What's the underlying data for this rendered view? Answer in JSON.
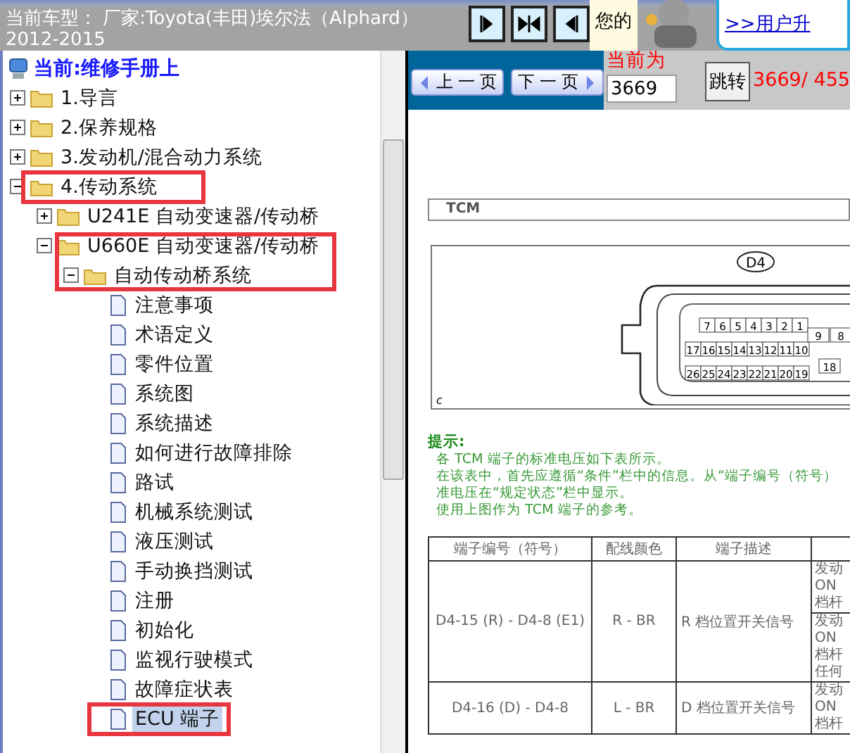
{
  "topbar": {
    "vehicle_line1": "当前车型： 厂家:Toyota(丰田)埃尔法（Alphard）",
    "vehicle_line2": "2012-2015",
    "view_buttons": [
      {
        "kind": "right"
      },
      {
        "kind": "both"
      },
      {
        "kind": "left"
      }
    ],
    "notice_text": "您的",
    "upgrade_link": ">>用户升"
  },
  "tree": {
    "header": "当前:维修手册上",
    "items": [
      {
        "label": "1.导言",
        "kind": "folder",
        "expanded": false,
        "selected": false
      },
      {
        "label": "2.保养规格",
        "kind": "folder",
        "expanded": false,
        "selected": false
      },
      {
        "label": "3.发动机/混合动力系统",
        "kind": "folder",
        "expanded": false,
        "selected": false
      },
      {
        "label": "4.传动系统",
        "kind": "folder",
        "expanded": true,
        "selected": false,
        "children": [
          {
            "label": "U241E 自动变速器/传动桥",
            "kind": "folder",
            "expanded": false,
            "selected": false
          },
          {
            "label": "U660E 自动变速器/传动桥",
            "kind": "folder",
            "expanded": true,
            "selected": false,
            "children": [
              {
                "label": "自动传动桥系统",
                "kind": "folder",
                "expanded": true,
                "selected": false,
                "children": [
                  {
                    "label": "注意事项",
                    "kind": "page",
                    "selected": false
                  },
                  {
                    "label": "术语定义",
                    "kind": "page",
                    "selected": false
                  },
                  {
                    "label": "零件位置",
                    "kind": "page",
                    "selected": false
                  },
                  {
                    "label": "系统图",
                    "kind": "page",
                    "selected": false
                  },
                  {
                    "label": "系统描述",
                    "kind": "page",
                    "selected": false
                  },
                  {
                    "label": "如何进行故障排除",
                    "kind": "page",
                    "selected": false
                  },
                  {
                    "label": "路试",
                    "kind": "page",
                    "selected": false
                  },
                  {
                    "label": "机械系统测试",
                    "kind": "page",
                    "selected": false
                  },
                  {
                    "label": "液压测试",
                    "kind": "page",
                    "selected": false
                  },
                  {
                    "label": "手动换挡测试",
                    "kind": "page",
                    "selected": false
                  },
                  {
                    "label": "注册",
                    "kind": "page",
                    "selected": false
                  },
                  {
                    "label": "初始化",
                    "kind": "page",
                    "selected": false
                  },
                  {
                    "label": "监视行驶模式",
                    "kind": "page",
                    "selected": false
                  },
                  {
                    "label": "故障症状表",
                    "kind": "page",
                    "selected": false
                  },
                  {
                    "label": "ECU 端子",
                    "kind": "page",
                    "selected": true
                  }
                ]
              }
            ]
          }
        ]
      }
    ]
  },
  "pager": {
    "prev": "上 一 页",
    "next": "下 一 页",
    "current_label": "当前为",
    "page_input": "3669",
    "jump": "跳转",
    "page_count": "3669/ 455"
  },
  "document": {
    "section_title": "TCM",
    "connector": {
      "label": "D4",
      "pin_rows": [
        [
          "7",
          "6",
          "5",
          "4",
          "3",
          "2",
          "1"
        ],
        [
          "17",
          "16",
          "15",
          "14",
          "13",
          "12",
          "11",
          "10"
        ],
        [
          "26",
          "25",
          "24",
          "23",
          "22",
          "21",
          "20",
          "19"
        ]
      ],
      "side_pins": [
        [
          "9",
          "8"
        ],
        [
          "18"
        ]
      ],
      "caption": "c"
    },
    "hint_title": "提示:",
    "hint_lines": [
      "各 TCM 端子的标准电压如下表所示。",
      "在该表中，首先应遵循“条件”栏中的信息。从“端子编号（符号）",
      "准电压在“规定状态”栏中显示。",
      "使用上图作为 TCM 端子的参考。"
    ],
    "table": {
      "columns": [
        "端子编号（符号）",
        "配线颜色",
        "端子描述"
      ],
      "rows": [
        {
          "terminal": "D4-15 (R) - D4-8 (E1)",
          "wire": "R - BR",
          "description": "R 档位置开关信号",
          "conditions": [
            [
              "发动",
              "ON",
              "档杆"
            ],
            [
              "发动",
              "ON",
              "档杆",
              "任何"
            ]
          ]
        },
        {
          "terminal": "D4-16 (D) - D4-8",
          "wire": "L - BR",
          "description": "D 档位置开关信号",
          "conditions": [
            [
              "发动",
              "ON",
              "档杆"
            ]
          ]
        }
      ]
    }
  },
  "annotations": [
    {
      "kind": "box"
    }
  ]
}
